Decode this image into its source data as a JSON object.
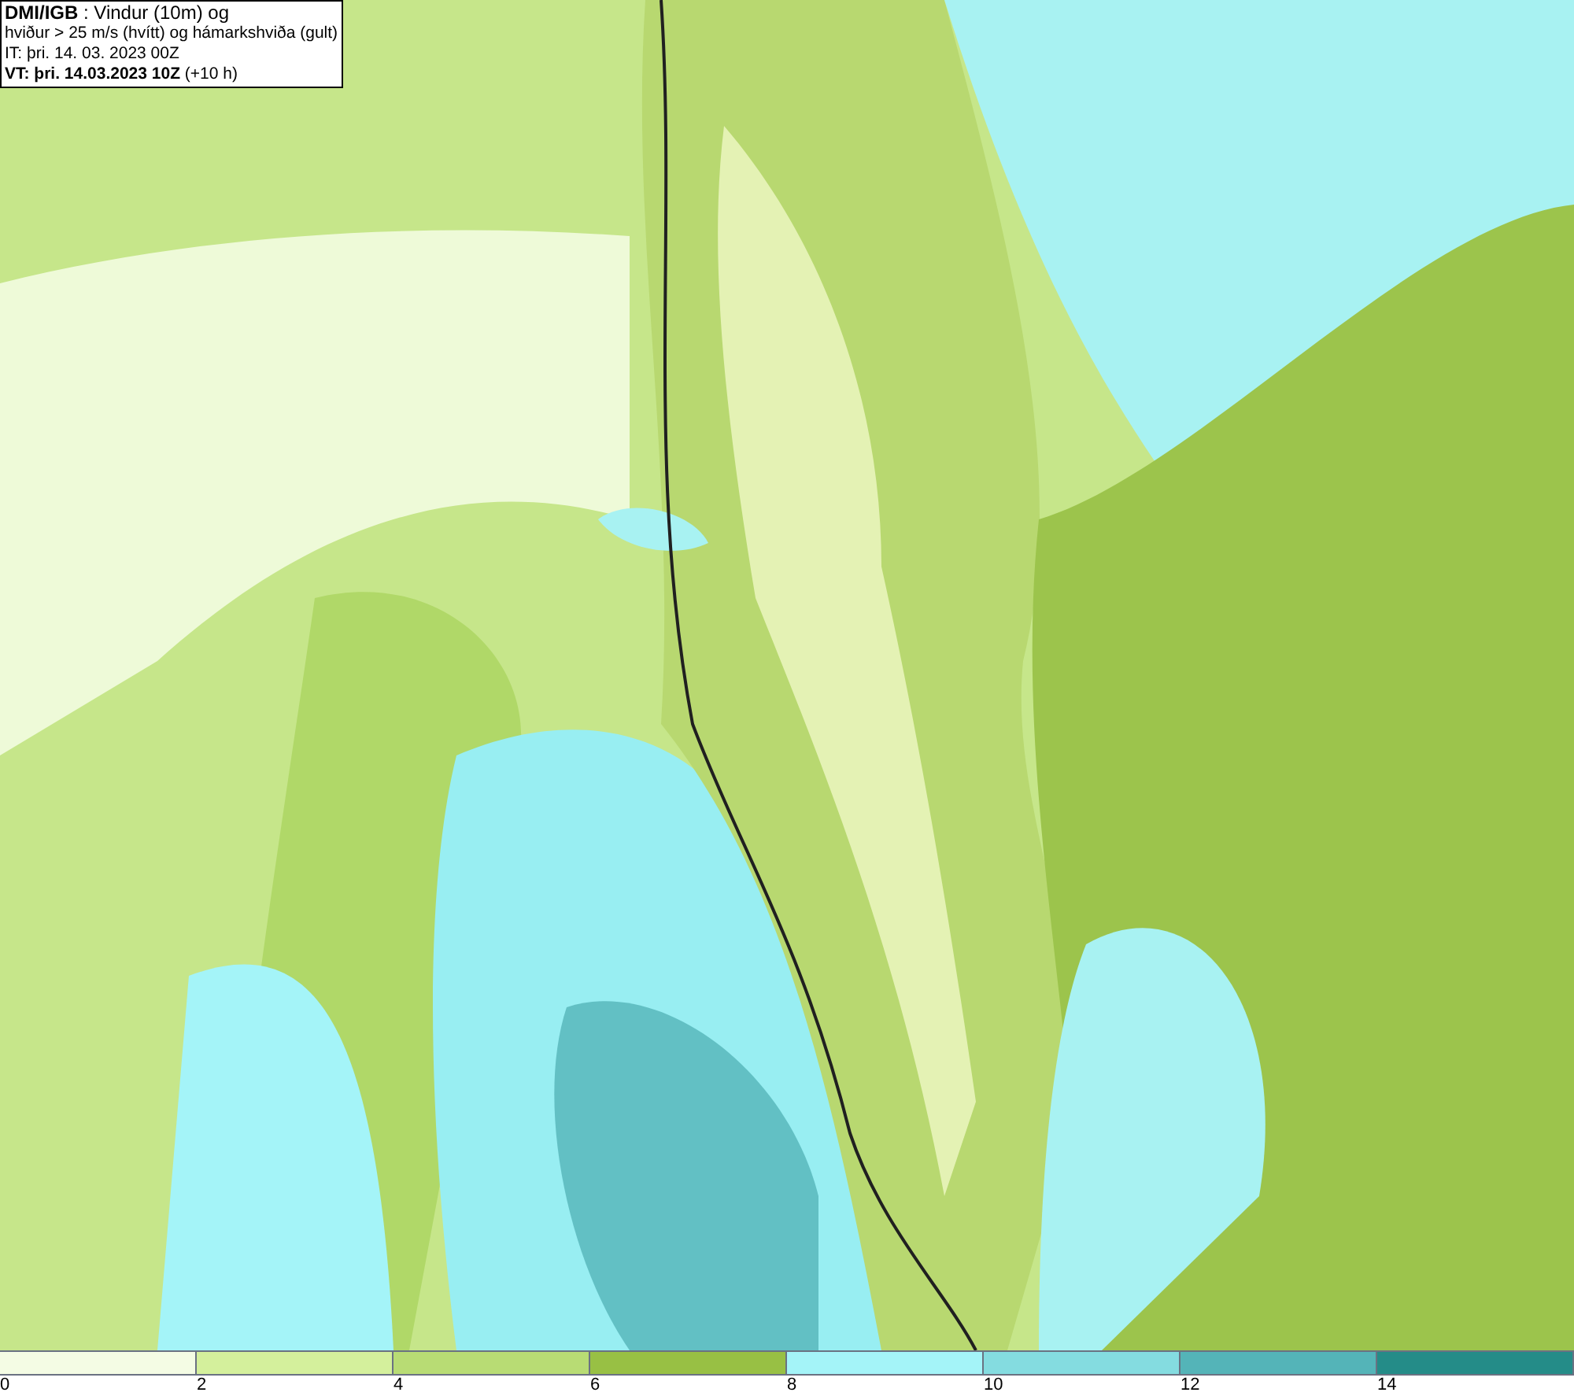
{
  "header": {
    "lines": [
      "**DMI/IGB** : Vindur (10m) og",
      "hviður > 25 m/s (hvítt) og hámarkshviða (gult)",
      "IT: þri. 14. 03. 2023 00Z",
      "**VT: þri. 14.03.2023 10Z** (+10 h)"
    ]
  },
  "legend": [
    {
      "label": "0",
      "color": "#f4fce4"
    },
    {
      "label": "2",
      "color": "#d4f09c"
    },
    {
      "label": "4",
      "color": "#b8dc74"
    },
    {
      "label": "6",
      "color": "#98c044"
    },
    {
      "label": "8",
      "color": "#a4f4f8"
    },
    {
      "label": "10",
      "color": "#84dce0"
    },
    {
      "label": "12",
      "color": "#54b4b8"
    },
    {
      "label": "14",
      "color": "#248c88"
    }
  ]
}
